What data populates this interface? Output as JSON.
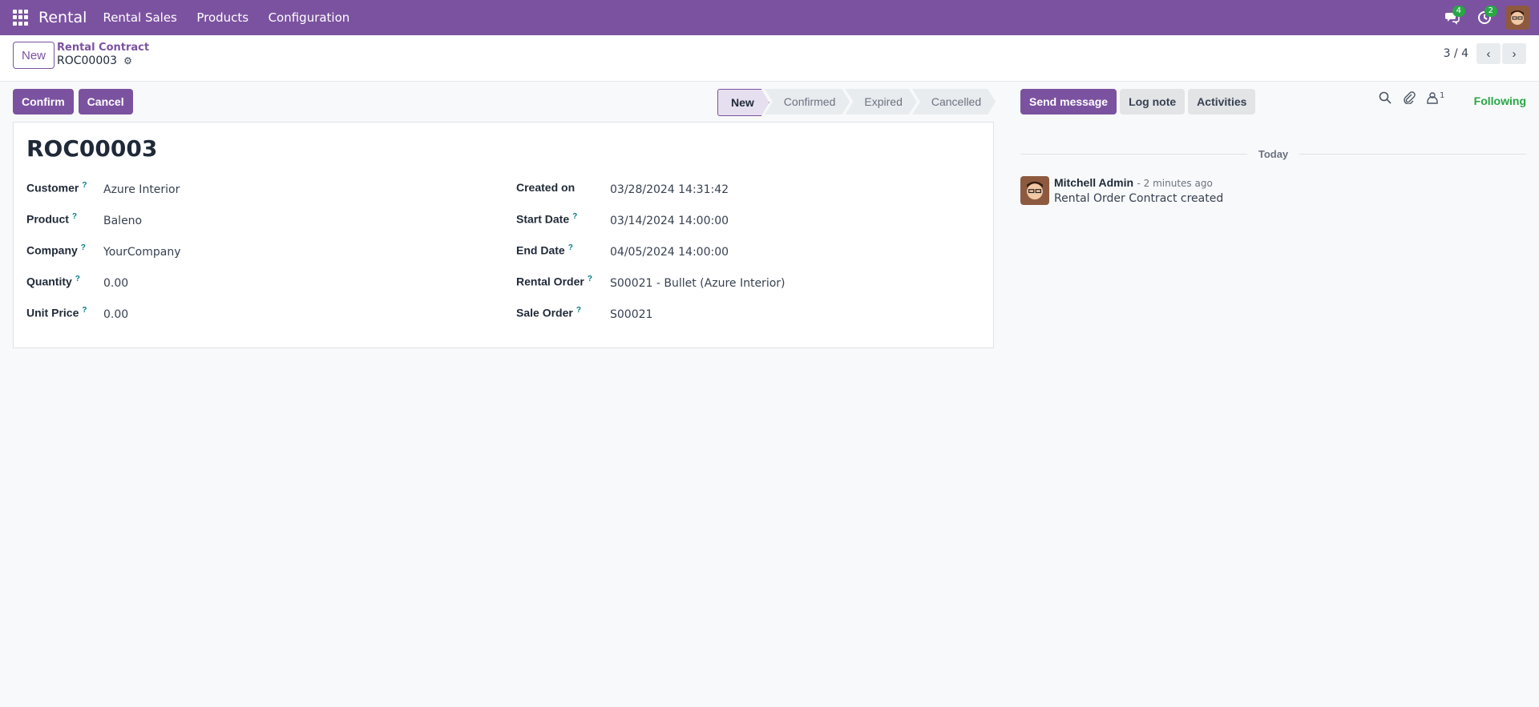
{
  "topbar": {
    "app_name": "Rental",
    "menu": [
      "Rental Sales",
      "Products",
      "Configuration"
    ],
    "messages_count": "4",
    "activities_count": "2"
  },
  "control": {
    "new_label": "New",
    "breadcrumb_parent": "Rental Contract",
    "breadcrumb_current": "ROC00003",
    "pager_value": "3 / 4"
  },
  "actions": {
    "confirm_label": "Confirm",
    "cancel_label": "Cancel"
  },
  "statusbar": {
    "stages": [
      "New",
      "Confirmed",
      "Expired",
      "Cancelled"
    ],
    "active": "New"
  },
  "record": {
    "title": "ROC00003",
    "left_fields": [
      {
        "label": "Customer",
        "value": "Azure Interior",
        "help": "?"
      },
      {
        "label": "Product",
        "value": "Baleno",
        "help": "?"
      },
      {
        "label": "Company",
        "value": "YourCompany",
        "help": "?"
      },
      {
        "label": "Quantity",
        "value": "0.00",
        "help": "?"
      },
      {
        "label": "Unit Price",
        "value": "0.00",
        "help": "?"
      }
    ],
    "right_fields": [
      {
        "label": "Created on",
        "value": "03/28/2024 14:31:42",
        "help": ""
      },
      {
        "label": "Start Date",
        "value": "03/14/2024 14:00:00",
        "help": "?"
      },
      {
        "label": "End Date",
        "value": "04/05/2024 14:00:00",
        "help": "?"
      },
      {
        "label": "Rental Order",
        "value": "S00021 - Bullet (Azure Interior)",
        "help": "?"
      },
      {
        "label": "Sale Order",
        "value": "S00021",
        "help": "?"
      }
    ]
  },
  "chatter": {
    "send_message_label": "Send message",
    "log_note_label": "Log note",
    "activities_label": "Activities",
    "followers_count": "1",
    "following_label": "Following",
    "day_label": "Today",
    "message": {
      "author": "Mitchell Admin",
      "time": "- 2 minutes ago",
      "body": "Rental Order Contract created"
    }
  },
  "colors": {
    "brand": "#7b52a0",
    "following": "#28a745",
    "help": "#017e84"
  }
}
